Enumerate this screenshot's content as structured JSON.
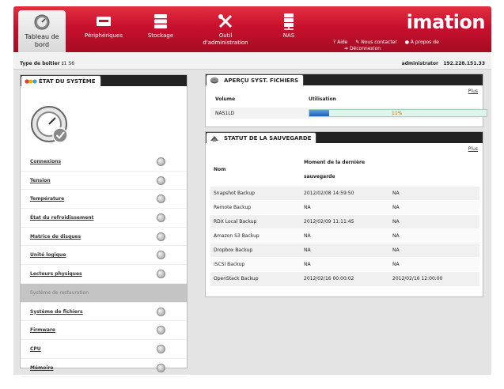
{
  "nav": {
    "items": [
      {
        "label": "Tableau de bord",
        "icon": "dashboard-icon",
        "active": true
      },
      {
        "label": "Périphériques",
        "icon": "device-icon",
        "active": false
      },
      {
        "label": "Stockage",
        "icon": "storage-icon",
        "active": false
      },
      {
        "label": "Outil d'administration",
        "icon": "tools-icon",
        "active": false
      },
      {
        "label": "NAS",
        "icon": "server-icon",
        "active": false
      }
    ],
    "brand": "imation",
    "links": {
      "help": "Aide",
      "contact": "Nous contacter",
      "about": "À propos de",
      "logout": "Déconnexion"
    }
  },
  "info": {
    "type_label": "Type de boîtier :",
    "type_value": "i1 S6",
    "admin": "administrator",
    "ip": "192.228.151.33"
  },
  "system": {
    "title": "ÉTAT DU SYSTÈME",
    "items": [
      {
        "label": "Connexions",
        "selected": false
      },
      {
        "label": "Tension",
        "selected": false
      },
      {
        "label": "Température",
        "selected": false
      },
      {
        "label": "État du refroidissement",
        "selected": false
      },
      {
        "label": "Matrice de disques",
        "selected": false
      },
      {
        "label": "Unité logique",
        "selected": false
      },
      {
        "label": "Lecteurs physiques",
        "selected": false
      },
      {
        "label": "Système de restauration",
        "selected": true
      },
      {
        "label": "Système de fichiers",
        "selected": false
      },
      {
        "label": "Firmware",
        "selected": false
      },
      {
        "label": "CPU",
        "selected": false
      },
      {
        "label": "Mémoire",
        "selected": false
      }
    ]
  },
  "fs": {
    "title": "APERÇU SYST. FICHIERS",
    "more": "Plus",
    "col_volume": "Volume",
    "col_usage": "Utilisation",
    "volume": "NAS1LD",
    "usage_percent": 11,
    "usage_text": "11%"
  },
  "backup": {
    "title": "STATUT DE LA SAUVEGARDE",
    "more": "Plus",
    "headers": [
      "Nom",
      "Moment de la dernière sauvegarde",
      ""
    ],
    "rows": [
      [
        "Snapshot Backup",
        "2012/02/08 14:59:50",
        "NA"
      ],
      [
        "Remote Backup",
        "NA",
        "NA"
      ],
      [
        "RDX Local Backup",
        "2012/02/09 11:11:45",
        "NA"
      ],
      [
        "Amazon S3 Backup",
        "NA",
        "NA"
      ],
      [
        "Dropbox Backup",
        "NA",
        "NA"
      ],
      [
        "iSCSI Backup",
        "NA",
        "NA"
      ],
      [
        "OpenStack Backup",
        "2012/02/16 00:00:02",
        "2012/02/16 12:00:00"
      ]
    ]
  },
  "colors": {
    "brand_red": "#c8102e",
    "header_dark": "#222222",
    "bar_blue": "#1e5fb4",
    "bar_track": "#e0f4ec"
  }
}
